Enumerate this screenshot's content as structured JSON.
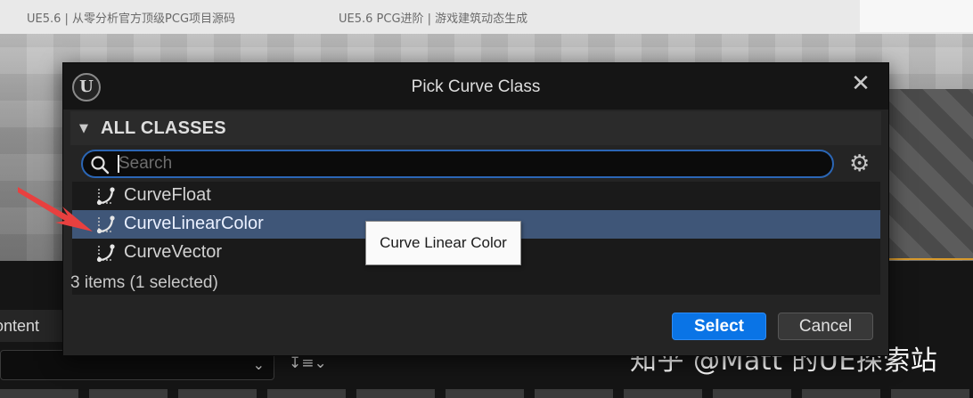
{
  "background": {
    "tabs": [
      "UE5.6 | 从零分析官方顶级PCG项目源码",
      "UE5.6 PCG进阶 | 游戏建筑动态生成"
    ],
    "content_tab_label": "ontent",
    "watermark": "知乎 @Matt 的UE探索站"
  },
  "dialog": {
    "title": "Pick Curve Class",
    "logo_text": "U",
    "close_glyph": "✕",
    "section_caret": "▼",
    "section_label": "ALL CLASSES",
    "search_placeholder": "Search",
    "settings_icon": "gear-icon",
    "items": [
      {
        "label": "CurveFloat",
        "icon": "curve-icon",
        "selected": false
      },
      {
        "label": "CurveLinearColor",
        "icon": "curve-icon",
        "selected": true
      },
      {
        "label": "CurveVector",
        "icon": "curve-icon",
        "selected": false
      }
    ],
    "item_count_text": "3 items (1 selected)",
    "tooltip": "Curve Linear Color",
    "select_label": "Select",
    "cancel_label": "Cancel"
  },
  "colors": {
    "accent": "#0a74e6",
    "selection": "#3f5678",
    "search_border": "#2b66b5",
    "annotation_arrow": "#e8403f"
  }
}
